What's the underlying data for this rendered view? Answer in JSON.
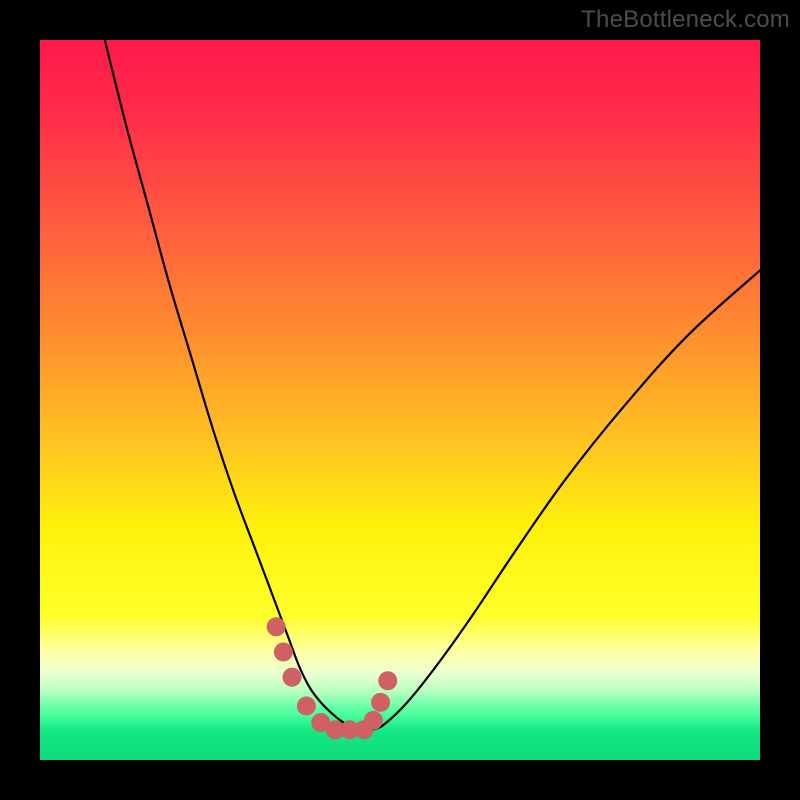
{
  "watermark": "TheBottleneck.com",
  "colors": {
    "frame_border": "#000000",
    "curve": "#000000",
    "dot_fill": "#cf6164",
    "gradient_stops": [
      {
        "offset": 0.0,
        "color": "#ff1a4b"
      },
      {
        "offset": 0.1,
        "color": "#ff2b4a"
      },
      {
        "offset": 0.25,
        "color": "#ff5b3f"
      },
      {
        "offset": 0.4,
        "color": "#ff8a30"
      },
      {
        "offset": 0.55,
        "color": "#ffc022"
      },
      {
        "offset": 0.68,
        "color": "#fff20b"
      },
      {
        "offset": 0.8,
        "color": "#ffff2b"
      },
      {
        "offset": 0.85,
        "color": "#ffffa8"
      },
      {
        "offset": 0.88,
        "color": "#eaffd0"
      },
      {
        "offset": 0.905,
        "color": "#b6ffc0"
      },
      {
        "offset": 0.92,
        "color": "#7dffb0"
      },
      {
        "offset": 0.935,
        "color": "#4dff9e"
      },
      {
        "offset": 0.96,
        "color": "#14e884"
      },
      {
        "offset": 1.0,
        "color": "#0fd97d"
      }
    ]
  },
  "chart_data": {
    "type": "line",
    "title": "",
    "xlabel": "",
    "ylabel": "",
    "xlim": [
      0,
      100
    ],
    "ylim": [
      0,
      100
    ],
    "grid": false,
    "series": [
      {
        "name": "bottleneck-curve",
        "x": [
          9,
          12,
          15,
          18,
          21,
          24,
          27,
          30,
          33,
          34.5,
          36,
          37.5,
          39,
          40.5,
          42,
          43.5,
          45,
          46.5,
          48,
          51,
          55,
          60,
          66,
          73,
          81,
          90,
          100
        ],
        "y": [
          100,
          88,
          77,
          66,
          56,
          46,
          37,
          29,
          21,
          17,
          13,
          10,
          8,
          6.5,
          5.3,
          4.5,
          4.1,
          4.3,
          5.1,
          8,
          13,
          20,
          29,
          39,
          49,
          59,
          68
        ]
      }
    ],
    "highlight_points": {
      "name": "highlight-dots",
      "x": [
        32.8,
        33.8,
        35.0,
        37.0,
        39.0,
        41.0,
        43.0,
        45.0,
        46.3,
        47.3,
        48.3
      ],
      "y": [
        18.5,
        15.0,
        11.5,
        7.5,
        5.2,
        4.2,
        4.2,
        4.2,
        5.5,
        8.0,
        11.0
      ]
    }
  }
}
